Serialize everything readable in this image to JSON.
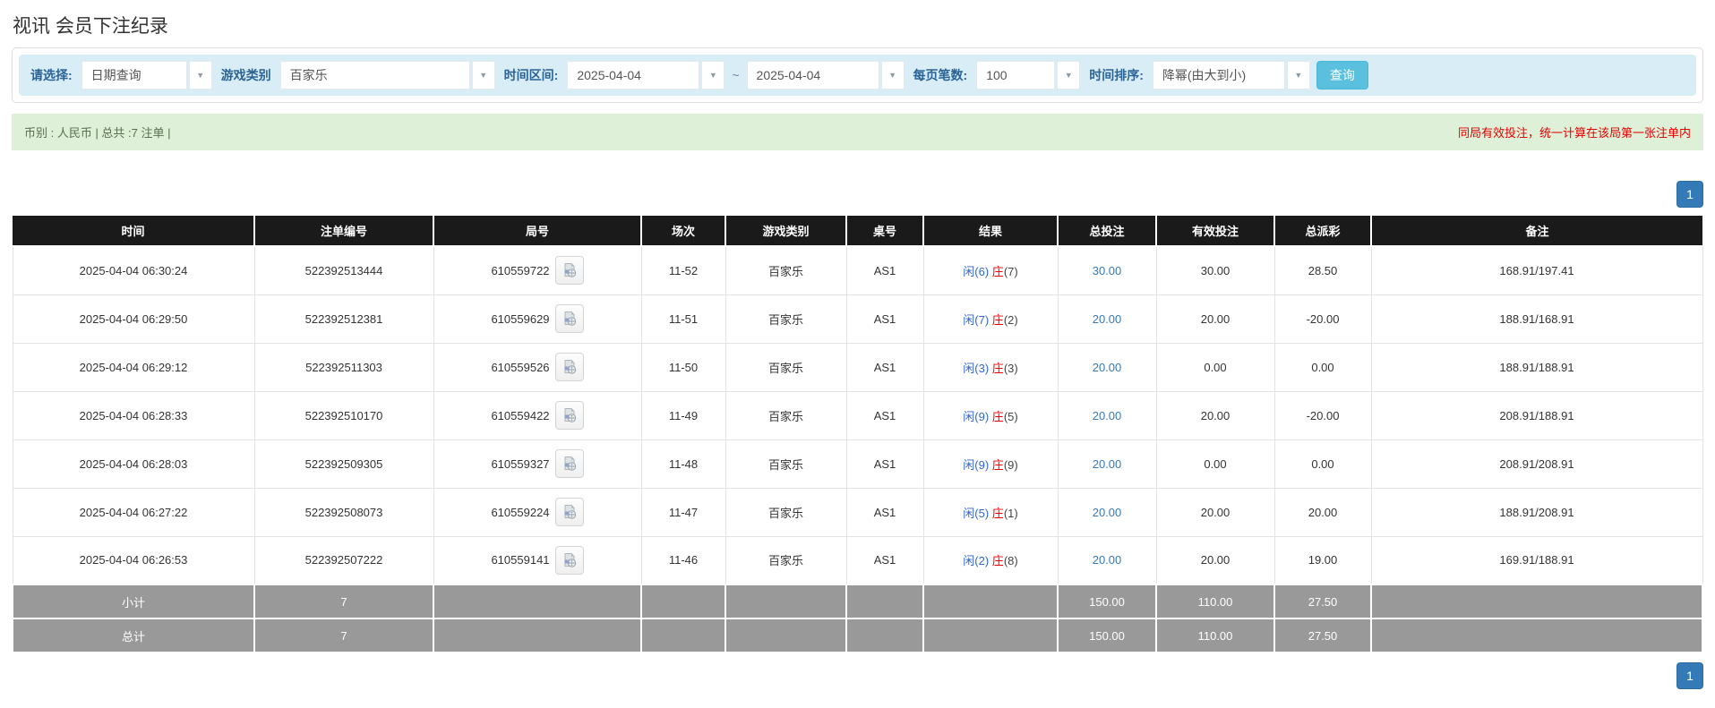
{
  "title": "视讯 会员下注纪录",
  "filters": {
    "select_label": "请选择:",
    "select_value": "日期查询",
    "game_type_label": "游戏类别",
    "game_type_value": "百家乐",
    "time_range_label": "时间区间:",
    "date_from": "2025-04-04",
    "range_separator": "~",
    "date_to": "2025-04-04",
    "page_size_label": "每页笔数:",
    "page_size_value": "100",
    "sort_label": "时间排序:",
    "sort_value": "降幂(由大到小)",
    "search_button": "查询"
  },
  "info_bar": {
    "left_text": "币别 : 人民币 | 总共 :7 注单 |",
    "right_text": "同局有效投注，统一计算在该局第一张注单内"
  },
  "pagination": {
    "page": "1"
  },
  "icons": {
    "dropdown_arrow": "▼",
    "video_icon": "video-replay-icon"
  },
  "table": {
    "headers": [
      "时间",
      "注单编号",
      "局号",
      "场次",
      "游戏类别",
      "桌号",
      "结果",
      "总投注",
      "有效投注",
      "总派彩",
      "备注"
    ],
    "rows": [
      {
        "time": "2025-04-04 06:30:24",
        "bet_id": "522392513444",
        "round_id": "610559722",
        "session": "11-52",
        "game": "百家乐",
        "table_no": "AS1",
        "result_player": "闲(6)",
        "result_banker": "庄",
        "result_banker_score": "(7)",
        "total_bet": "30.00",
        "valid_bet": "30.00",
        "payout": "28.50",
        "remark": "168.91/197.41"
      },
      {
        "time": "2025-04-04 06:29:50",
        "bet_id": "522392512381",
        "round_id": "610559629",
        "session": "11-51",
        "game": "百家乐",
        "table_no": "AS1",
        "result_player": "闲(7)",
        "result_banker": "庄",
        "result_banker_score": "(2)",
        "total_bet": "20.00",
        "valid_bet": "20.00",
        "payout": "-20.00",
        "remark": "188.91/168.91"
      },
      {
        "time": "2025-04-04 06:29:12",
        "bet_id": "522392511303",
        "round_id": "610559526",
        "session": "11-50",
        "game": "百家乐",
        "table_no": "AS1",
        "result_player": "闲(3)",
        "result_banker": "庄",
        "result_banker_score": "(3)",
        "total_bet": "20.00",
        "valid_bet": "0.00",
        "payout": "0.00",
        "remark": "188.91/188.91"
      },
      {
        "time": "2025-04-04 06:28:33",
        "bet_id": "522392510170",
        "round_id": "610559422",
        "session": "11-49",
        "game": "百家乐",
        "table_no": "AS1",
        "result_player": "闲(9)",
        "result_banker": "庄",
        "result_banker_score": "(5)",
        "total_bet": "20.00",
        "valid_bet": "20.00",
        "payout": "-20.00",
        "remark": "208.91/188.91"
      },
      {
        "time": "2025-04-04 06:28:03",
        "bet_id": "522392509305",
        "round_id": "610559327",
        "session": "11-48",
        "game": "百家乐",
        "table_no": "AS1",
        "result_player": "闲(9)",
        "result_banker": "庄",
        "result_banker_score": "(9)",
        "total_bet": "20.00",
        "valid_bet": "0.00",
        "payout": "0.00",
        "remark": "208.91/208.91"
      },
      {
        "time": "2025-04-04 06:27:22",
        "bet_id": "522392508073",
        "round_id": "610559224",
        "session": "11-47",
        "game": "百家乐",
        "table_no": "AS1",
        "result_player": "闲(5)",
        "result_banker": "庄",
        "result_banker_score": "(1)",
        "total_bet": "20.00",
        "valid_bet": "20.00",
        "payout": "20.00",
        "remark": "188.91/208.91"
      },
      {
        "time": "2025-04-04 06:26:53",
        "bet_id": "522392507222",
        "round_id": "610559141",
        "session": "11-46",
        "game": "百家乐",
        "table_no": "AS1",
        "result_player": "闲(2)",
        "result_banker": "庄",
        "result_banker_score": "(8)",
        "total_bet": "20.00",
        "valid_bet": "20.00",
        "payout": "19.00",
        "remark": "169.91/188.91"
      }
    ],
    "subtotal": {
      "label": "小计",
      "count": "7",
      "total_bet": "150.00",
      "valid_bet": "110.00",
      "payout": "27.50"
    },
    "total": {
      "label": "总计",
      "count": "7",
      "total_bet": "150.00",
      "valid_bet": "110.00",
      "payout": "27.50"
    }
  },
  "colors": {
    "accent_blue": "#337ab7",
    "search_button": "#5bc0de",
    "filter_bg": "#d9edf7",
    "info_bg": "#dff0d8",
    "header_bg": "#1a1a1a",
    "footer_bg": "#999999",
    "negative_red": "#ff0000",
    "player_blue": "#3366cc",
    "banker_red": "#e60000"
  }
}
